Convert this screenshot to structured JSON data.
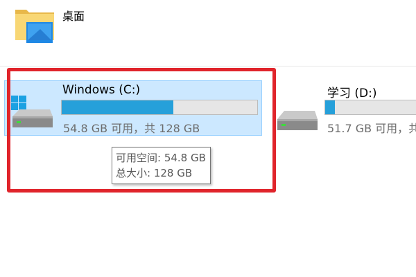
{
  "desktop_folder": {
    "label": "桌面",
    "icon": "desktop-folder-icon"
  },
  "drives": [
    {
      "name": "Windows (C:)",
      "space_text": "54.8 GB 可用，共 128 GB",
      "used_fraction": 0.572,
      "selected": true,
      "icon": "windows-drive-icon"
    },
    {
      "name": "学习 (D:)",
      "space_text": "51.7 GB 可用，共",
      "used_fraction": 0.05,
      "selected": false,
      "icon": "hard-drive-icon"
    }
  ],
  "tooltip": {
    "free_space": "可用空间: 54.8 GB",
    "total_size": "总大小: 128 GB"
  },
  "colors": {
    "selection_bg": "#cce8ff",
    "selection_border": "#99d1ff",
    "bar_fill": "#26a0da",
    "bar_track": "#e6e6e6",
    "highlight": "#e0242b"
  }
}
